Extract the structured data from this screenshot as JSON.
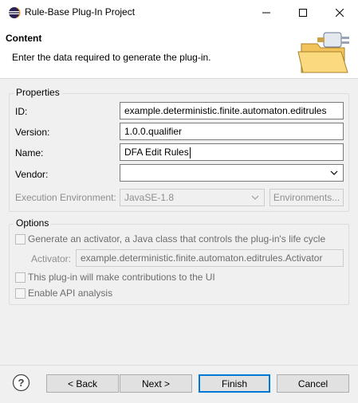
{
  "window": {
    "title": "Rule-Base Plug-In Project",
    "app_icon": "eclipse-icon",
    "controls": [
      "minimize-icon",
      "maximize-icon",
      "close-icon"
    ]
  },
  "header": {
    "title": "Content",
    "description": "Enter the data required to generate the plug-in.",
    "image": "plugin-folder-wizard-icon"
  },
  "properties": {
    "legend": "Properties",
    "id_label": "ID:",
    "id_value": "example.deterministic.finite.automaton.editrules",
    "version_label": "Version:",
    "version_value": "1.0.0.qualifier",
    "name_label": "Name:",
    "name_value": "DFA Edit Rules",
    "vendor_label": "Vendor:",
    "vendor_value": "",
    "env_label": "Execution Environment:",
    "env_value": "JavaSE-1.8",
    "env_button": "Environments..."
  },
  "options": {
    "legend": "Options",
    "generate_activator": "Generate an activator, a Java class that controls the plug-in's life cycle",
    "activator_label": "Activator:",
    "activator_value": "example.deterministic.finite.automaton.editrules.Activator",
    "contribute_ui": "This plug-in will make contributions to the UI",
    "enable_api": "Enable API analysis"
  },
  "footer": {
    "help_icon": "help-icon",
    "back": "< Back",
    "next": "Next >",
    "finish": "Finish",
    "cancel": "Cancel"
  }
}
